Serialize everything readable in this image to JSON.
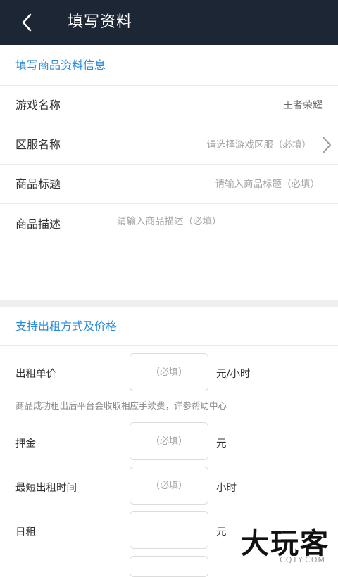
{
  "header": {
    "back_icon": "chevron-left-icon",
    "title": "填写资料"
  },
  "product_section": {
    "title": "填写商品资料信息",
    "game_name": {
      "label": "游戏名称",
      "value": "王者荣耀"
    },
    "server_name": {
      "label": "区服名称",
      "placeholder": "请选择游戏区服（必填）",
      "icon": "chevron-right-icon"
    },
    "product_title": {
      "label": "商品标题",
      "placeholder": "请输入商品标题（必填）"
    },
    "product_desc": {
      "label": "商品描述",
      "placeholder": "请输入商品描述（必填）"
    }
  },
  "rental_section": {
    "title": "支持出租方式及价格",
    "unit_price": {
      "label": "出租单价",
      "placeholder": "（必填）",
      "unit": "元/小时"
    },
    "fee_note": "商品成功租出后平台会收取相应手续费，详参帮助中心",
    "deposit": {
      "label": "押金",
      "placeholder": "（必填）",
      "unit": "元"
    },
    "min_time": {
      "label": "最短出租时间",
      "placeholder": "（必填）",
      "unit": "小时"
    },
    "daily": {
      "label": "日租",
      "placeholder": "",
      "unit": "元"
    }
  },
  "watermark": {
    "text": "大玩客",
    "sub": "CQTY.COM"
  }
}
